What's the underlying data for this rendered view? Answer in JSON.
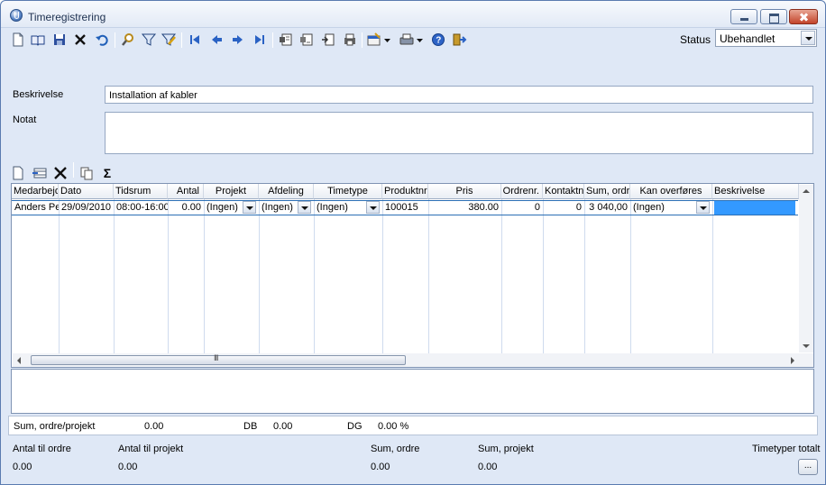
{
  "window": {
    "title": "Timeregistrering"
  },
  "toolbar": {
    "icons": [
      "new-document-icon",
      "open-book-icon",
      "save-icon",
      "delete-icon",
      "undo-icon",
      "search-icon",
      "filter-icon",
      "clear-filter-icon",
      "first-record-icon",
      "previous-record-icon",
      "next-record-icon",
      "last-record-icon",
      "report-icon",
      "report-detail-icon",
      "export-icon",
      "print-preview-icon",
      "settings-dropdown-icon",
      "print-dropdown-icon",
      "help-icon",
      "exit-icon"
    ],
    "status_label": "Status",
    "status_value": "Ubehandlet"
  },
  "form": {
    "description_label": "Beskrivelse",
    "description_value": "Installation af kabler",
    "note_label": "Notat",
    "note_value": ""
  },
  "grid_toolbar": {
    "icons": [
      "new-row-icon",
      "insert-row-icon",
      "delete-row-icon",
      "copy-icon",
      "sum-icon"
    ],
    "sum_glyph": "Σ"
  },
  "grid": {
    "columns": [
      "Medarbejder",
      "Dato",
      "Tidsrum",
      "Antal",
      "Projekt",
      "Afdeling",
      "Timetype",
      "Produktnr.",
      "Pris",
      "Ordrenr.",
      "Kontaktnr.",
      "Sum, ordre",
      "Kan overføres",
      "Beskrivelse"
    ],
    "rows": [
      {
        "medarbejder": "Anders Pe",
        "dato": "29/09/2010",
        "tidsrum": "08:00-16:00",
        "antal": "0.00",
        "projekt": "(Ingen)",
        "afdeling": "(Ingen)",
        "timetype": "(Ingen)",
        "produktnr": "100015",
        "pris": "380.00",
        "ordrenr": "0",
        "kontaktnr": "0",
        "sum_ordre": "3 040,00",
        "kan_overfores": "(Ingen)",
        "beskrivelse": ""
      }
    ],
    "scroll_grip": "III"
  },
  "summary": {
    "sum_label": "Sum, ordre/projekt",
    "sum_value": "0.00",
    "db_label": "DB",
    "db_value": "0.00",
    "dg_label": "DG",
    "dg_value": "0.00 %"
  },
  "footer": {
    "antal_ordre_label": "Antal til ordre",
    "antal_ordre_value": "0.00",
    "antal_projekt_label": "Antal til projekt",
    "antal_projekt_value": "0.00",
    "sum_ordre_label": "Sum, ordre",
    "sum_ordre_value": "0.00",
    "sum_projekt_label": "Sum, projekt",
    "sum_projekt_value": "0.00",
    "timetyper_label": "Timetyper totalt",
    "more_button": "..."
  }
}
